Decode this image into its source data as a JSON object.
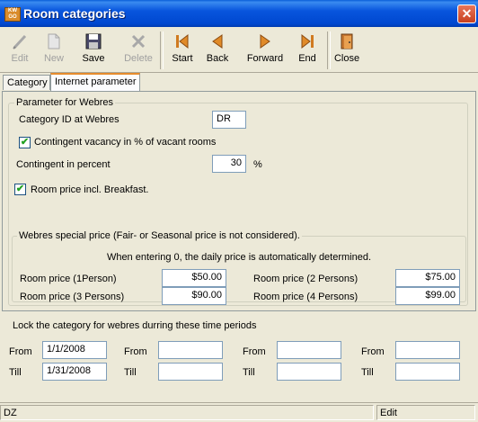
{
  "window": {
    "title": "Room categories",
    "icon_text": "KW GO",
    "close_glyph": "✕"
  },
  "toolbar": {
    "edit": "Edit",
    "new": "New",
    "save": "Save",
    "delete": "Delete",
    "start": "Start",
    "back": "Back",
    "forward": "Forward",
    "end": "End",
    "close": "Close"
  },
  "tabs": {
    "category": "Category",
    "internet": "Internet parameter"
  },
  "webres": {
    "legend": "Parameter for Webres",
    "category_id_label": "Category ID at Webres",
    "category_id_value": "DR",
    "contingent_checkbox_label": "Contingent vacancy in % of vacant rooms",
    "contingent_checked": true,
    "contingent_percent_label": "Contingent in percent",
    "contingent_percent_value": "30",
    "percent_unit": "%",
    "breakfast_label": "Room price incl. Breakfast.",
    "breakfast_checked": true
  },
  "special": {
    "legend": "Webres special price (Fair- or Seasonal price is not considered).",
    "note": "When entering 0, the daily price is automatically determined.",
    "p1_label": "Room price (1Person)",
    "p1_value": "$50.00",
    "p2_label": "Room price (2 Persons)",
    "p2_value": "$75.00",
    "p3_label": "Room price (3 Persons)",
    "p3_value": "$90.00",
    "p4_label": "Room price (4 Persons)",
    "p4_value": "$99.00"
  },
  "lock": {
    "heading": "Lock the category for webres durring these time periods",
    "from_label": "From",
    "till_label": "Till",
    "from": [
      "1/1/2008",
      "",
      "",
      ""
    ],
    "till": [
      "1/31/2008",
      "",
      "",
      ""
    ]
  },
  "status": {
    "left": "DZ",
    "mode": "Edit"
  },
  "check_glyph": "✔"
}
